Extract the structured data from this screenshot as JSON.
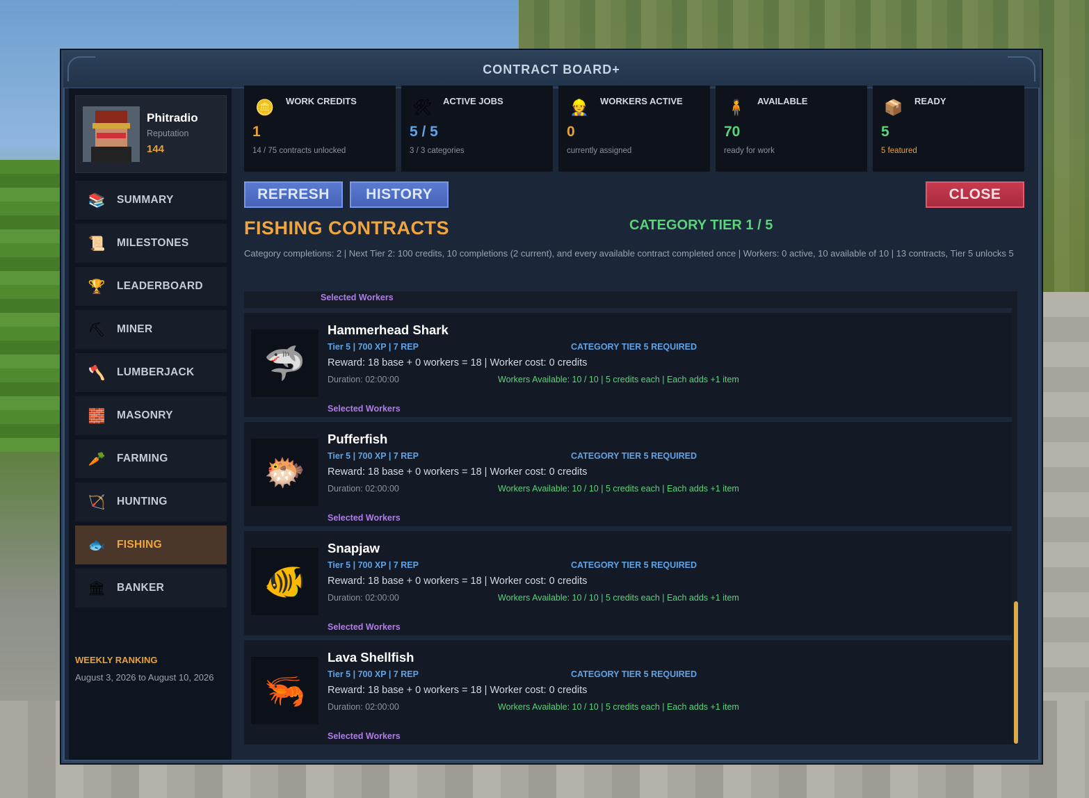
{
  "window": {
    "title": "CONTRACT BOARD+"
  },
  "profile": {
    "name": "Phitradio",
    "reputation_label": "Reputation",
    "reputation_value": "144"
  },
  "sidebar": {
    "items": [
      {
        "label": "SUMMARY",
        "icon": "books-icon",
        "glyph": "📚",
        "active": false
      },
      {
        "label": "MILESTONES",
        "icon": "map-icon",
        "glyph": "📜",
        "active": false
      },
      {
        "label": "LEADERBOARD",
        "icon": "trophy-icon",
        "glyph": "🏆",
        "active": false
      },
      {
        "label": "MINER",
        "icon": "pickaxe-icon",
        "glyph": "⛏",
        "active": false
      },
      {
        "label": "LUMBERJACK",
        "icon": "axe-icon",
        "glyph": "🪓",
        "active": false
      },
      {
        "label": "MASONRY",
        "icon": "trowel-icon",
        "glyph": "🧱",
        "active": false
      },
      {
        "label": "FARMING",
        "icon": "carrot-icon",
        "glyph": "🥕",
        "active": false
      },
      {
        "label": "HUNTING",
        "icon": "bow-icon",
        "glyph": "🏹",
        "active": false
      },
      {
        "label": "FISHING",
        "icon": "fish-icon",
        "glyph": "🐟",
        "active": true
      },
      {
        "label": "BANKER",
        "icon": "bank-icon",
        "glyph": "🏛",
        "active": false
      }
    ],
    "weekly_title": "WEEKLY RANKING",
    "weekly_dates": "August 3, 2026 to August 10, 2026"
  },
  "stats": [
    {
      "title": "WORK CREDITS",
      "value": "1",
      "sub": "14 / 75 contracts unlocked",
      "icon": "coin-icon",
      "glyph": "🪙",
      "value_color": "#e8a23a",
      "sub_color": "#8a93a0"
    },
    {
      "title": "ACTIVE JOBS",
      "value": "5 / 5",
      "sub": "3 / 3 categories",
      "icon": "wagon-icon",
      "glyph": "🛠",
      "value_color": "#5fa3e6",
      "sub_color": "#8a93a0"
    },
    {
      "title": "WORKERS ACTIVE",
      "value": "0",
      "sub": "currently assigned",
      "icon": "worker-icon",
      "glyph": "👷",
      "value_color": "#e8a23a",
      "sub_color": "#8a93a0"
    },
    {
      "title": "AVAILABLE",
      "value": "70",
      "sub": "ready for work",
      "icon": "villager-icon",
      "glyph": "🧍",
      "value_color": "#5ad37a",
      "sub_color": "#8a93a0"
    },
    {
      "title": "READY",
      "value": "5",
      "sub": "5 featured",
      "icon": "chest-icon",
      "glyph": "📦",
      "value_color": "#5ad37a",
      "sub_color": "#e8a23a"
    }
  ],
  "buttons": {
    "refresh": "REFRESH",
    "history": "HISTORY",
    "close": "CLOSE"
  },
  "section": {
    "title": "FISHING CONTRACTS",
    "tier": "CATEGORY TIER 1 / 5",
    "info": "Category completions: 2 | Next Tier 2: 100 credits, 10 completions (2 current), and every available contract completed once | Workers: 0 active, 10 available of 10 | 13 contracts, Tier 5 unlocks 5"
  },
  "selected_workers_label": "Selected Workers",
  "contracts": [
    {
      "name": "Hammerhead Shark",
      "tier": "Tier 5 | 700 XP | 7 REP",
      "requirement": "CATEGORY TIER 5 REQUIRED",
      "reward": "Reward: 18 base + 0 workers = 18 | Worker cost: 0 credits",
      "duration": "Duration: 02:00:00",
      "workers": "Workers Available: 10 / 10 | 5 credits each | Each adds +1 item",
      "selected": "Selected Workers",
      "icon": "shark-icon",
      "glyph": "🦈"
    },
    {
      "name": "Pufferfish",
      "tier": "Tier 5 | 700 XP | 7 REP",
      "requirement": "CATEGORY TIER 5 REQUIRED",
      "reward": "Reward: 18 base + 0 workers = 18 | Worker cost: 0 credits",
      "duration": "Duration: 02:00:00",
      "workers": "Workers Available: 10 / 10 | 5 credits each | Each adds +1 item",
      "selected": "Selected Workers",
      "icon": "pufferfish-icon",
      "glyph": "🐡"
    },
    {
      "name": "Snapjaw",
      "tier": "Tier 5 | 700 XP | 7 REP",
      "requirement": "CATEGORY TIER 5 REQUIRED",
      "reward": "Reward: 18 base + 0 workers = 18 | Worker cost: 0 credits",
      "duration": "Duration: 02:00:00",
      "workers": "Workers Available: 10 / 10 | 5 credits each | Each adds +1 item",
      "selected": "Selected Workers",
      "icon": "snapjaw-icon",
      "glyph": "🐠"
    },
    {
      "name": "Lava Shellfish",
      "tier": "Tier 5 | 700 XP | 7 REP",
      "requirement": "CATEGORY TIER 5 REQUIRED",
      "reward": "Reward: 18 base + 0 workers = 18 | Worker cost: 0 credits",
      "duration": "Duration: 02:00:00",
      "workers": "Workers Available: 10 / 10 | 5 credits each | Each adds +1 item",
      "selected": "Selected Workers",
      "icon": "shellfish-icon",
      "glyph": "🦐"
    }
  ]
}
